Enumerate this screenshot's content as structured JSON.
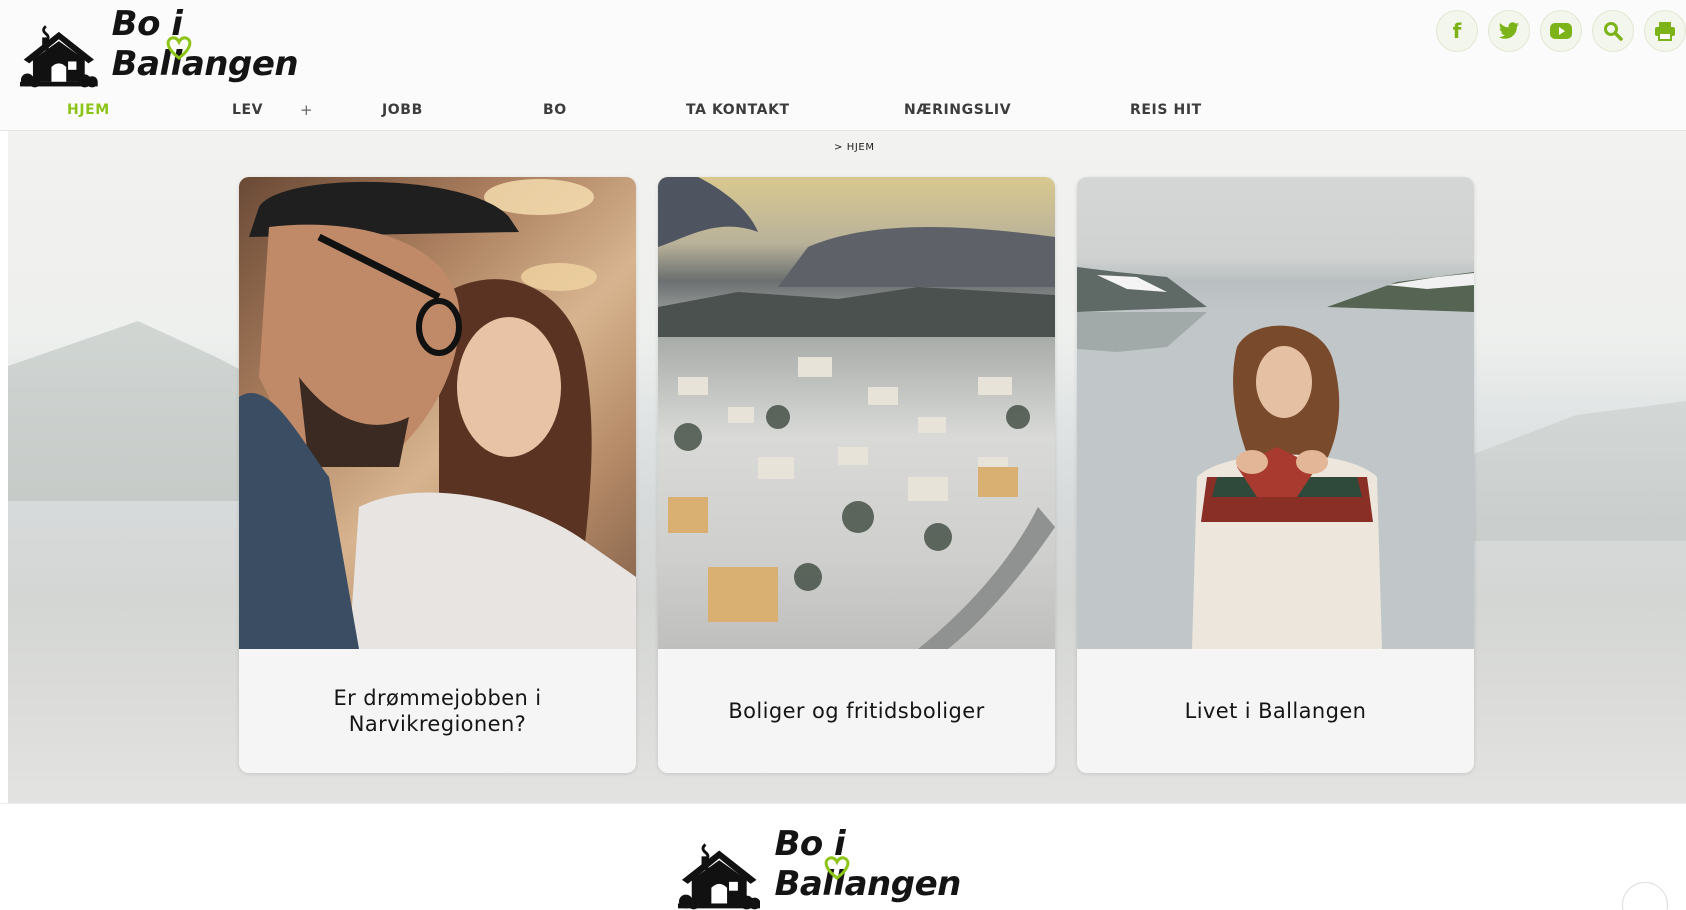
{
  "brand": {
    "name": "Bo i Ballangen",
    "accent": "#8cc418"
  },
  "social": [
    {
      "name": "facebook",
      "glyph": "f"
    },
    {
      "name": "twitter",
      "glyph": ""
    },
    {
      "name": "youtube",
      "glyph": ""
    },
    {
      "name": "search",
      "glyph": ""
    },
    {
      "name": "print",
      "glyph": ""
    }
  ],
  "nav": {
    "items": [
      {
        "label": "HJEM",
        "active": true
      },
      {
        "label": "LEV",
        "active": false
      },
      {
        "label": "JOBB",
        "active": false
      },
      {
        "label": "BO",
        "active": false
      },
      {
        "label": "TA KONTAKT",
        "active": false
      },
      {
        "label": "NÆRINGSLIV",
        "active": false
      },
      {
        "label": "REIS HIT",
        "active": false
      }
    ],
    "plus": "+"
  },
  "breadcrumb": "> HJEM",
  "cards": [
    {
      "caption": "Er drømmejobben i Narvikregionen?"
    },
    {
      "caption": "Boliger og fritidsboliger"
    },
    {
      "caption": "Livet i Ballangen"
    }
  ],
  "footer": {
    "logo_text": "Bo i Ballangen"
  }
}
